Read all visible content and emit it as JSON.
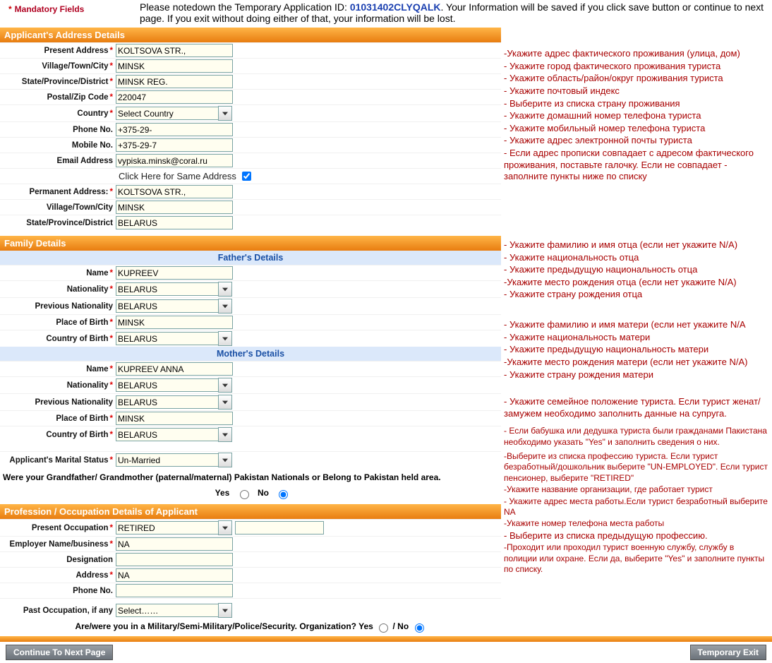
{
  "mandatory_label": "Mandatory Fields",
  "notice_pre": "Please notedown the Temporary Application ID: ",
  "app_id": "01031402CLYQALK",
  "notice_post": ". Your Information will be saved if you click save button or continue to next page. If you exit without doing either of that, your information will be lost.",
  "sections": {
    "address": "Applicant's Address Details",
    "family": "Family Details",
    "profession": "Profession / Occupation Details of Applicant"
  },
  "subsections": {
    "father": "Father's Details",
    "mother": "Mother's Details"
  },
  "labels": {
    "present_address": "Present Address",
    "village": "Village/Town/City",
    "state": "State/Province/District",
    "postal": "Postal/Zip Code",
    "country": "Country",
    "phone": "Phone No.",
    "mobile": "Mobile No.",
    "email": "Email Address",
    "same_addr": "Click Here for Same Address",
    "permanent_address": "Permanent Address:",
    "name": "Name",
    "nationality": "Nationality",
    "prev_nationality": "Previous Nationality",
    "pob": "Place of Birth",
    "cob": "Country of Birth",
    "marital": "Applicant's Marital Status",
    "present_occ": "Present Occupation",
    "employer": "Employer Name/business",
    "designation": "Designation",
    "address": "Address",
    "past_occ": "Past Occupation, if any"
  },
  "values": {
    "present_address": "KOLTSOVA STR.,",
    "village": "MINSK",
    "state": "MINSK REG.",
    "postal": "220047",
    "country": "Select Country",
    "phone": "+375-29-",
    "mobile": "+375-29-7",
    "email": "vypiska.minsk@coral.ru",
    "perm_address": "KOLTSOVA STR.,",
    "perm_village": "MINSK",
    "perm_state": "BELARUS",
    "father_name": "KUPREEV",
    "father_nat": "BELARUS",
    "father_prev": "BELARUS",
    "father_pob": "MINSK",
    "father_cob": "BELARUS",
    "mother_name": "KUPREEV ANNA",
    "mother_nat": "BELARUS",
    "mother_prev": "BELARUS",
    "mother_pob": "MINSK",
    "mother_cob": "BELARUS",
    "marital": "Un-Married",
    "present_occ": "RETIRED",
    "employer": "NA",
    "designation": "",
    "occ_address": "NA",
    "occ_phone": "",
    "past_occ": "Select……"
  },
  "questions": {
    "pakistan": "Were your Grandfather/ Grandmother (paternal/maternal) Pakistan Nationals or Belong to Pakistan held area.",
    "military": "Are/were you in a Military/Semi-Military/Police/Security. Organization? Yes",
    "yes": "Yes",
    "no": "No",
    "slash_no": "/ No"
  },
  "buttons": {
    "continue": "Continue To Next Page",
    "exit": "Temporary Exit"
  },
  "instructions": {
    "addr1": "-Укажите адрес фактического проживания (улица, дом)",
    "addr2": "- Укажите город фактического проживания туриста",
    "addr3": "- Укажите область/район/округ проживания туриста",
    "addr4": "- Укажите почтовый индекс",
    "addr5": "- Выберите из списка страну проживания",
    "addr6": "- Укажите домашний номер телефона туриста",
    "addr7": "- Укажите мобильный номер телефона туриста",
    "addr8": "- Укажите адрес электронной почты туриста",
    "addr9": "- Если адрес прописки совпадает с адресом фактического проживания, поставьте галочку. Если не совпадает - заполните пункты ниже по списку",
    "fat1": "- Укажите  фамилию и имя отца (если нет укажите N/A)",
    "fat2": "- Укажите национальность отца",
    "fat3": "- Укажите предыдущую национальность отца",
    "fat4": "-Укажите место рождения отца (если нет укажите N/A)",
    "fat5": "- Укажите страну рождения отца",
    "mot1": "- Укажите  фамилию и имя матери (если нет укажите N/A",
    "mot2": "- Укажите национальность матери",
    "mot3": "- Укажите предыдущую национальность матери",
    "mot4": "-Укажите место рождения матери (если нет укажите N/A)",
    "mot5": "- Укажите страну рождения матери",
    "mar": "- Укажите семейное положение туриста. Если турист женат/замужем необходимо заполнить данные на супруга.",
    "pak": "- Если бабушка или дедушка туриста были гражданами Пакистана необходимо указать \"Yes\" и заполнить сведения о них.",
    "occ1": "-Выберите из списка профессию туриста. Если турист безработный/дошкольник выберите \"UN-EMPLOYED\". Если турист пенсионер, выберите \"RETIRED\"",
    "occ2": "-Укажите название организации, где работает турист",
    "occ3": "- Укажите адрес места работы.Если турист безработный выберите NA",
    "occ4": "-Укажите номер телефона места работы",
    "occ5": "- Выберите из списка предыдущую профессию.",
    "mil": "-Проходит или проходил турист военную службу, службу в полиции или охране. Если да, выберите \"Yes\" и заполните пункты по списку."
  }
}
